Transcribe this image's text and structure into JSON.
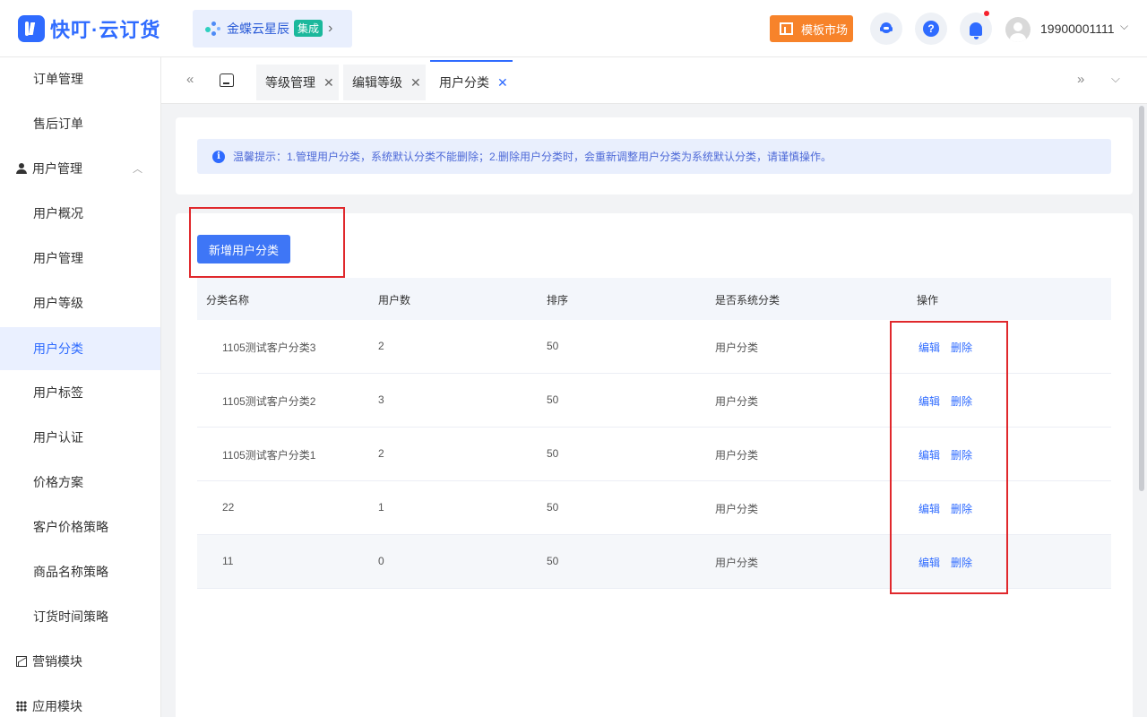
{
  "header": {
    "logo_text": "快叮·云订货",
    "company": "金蝶云星辰",
    "company_badge": "集成",
    "market_btn": "模板市场",
    "help_glyph": "?",
    "username": "19900001111",
    "icons": [
      "support-icon",
      "help-icon",
      "bell-icon",
      "avatar"
    ]
  },
  "sidebar": {
    "items": [
      {
        "label": "订单管理",
        "type": "sub"
      },
      {
        "label": "售后订单",
        "type": "sub"
      },
      {
        "label": "用户管理",
        "type": "group",
        "icon": "person-icon",
        "expanded": true
      },
      {
        "label": "用户概况",
        "type": "sub"
      },
      {
        "label": "用户管理",
        "type": "sub"
      },
      {
        "label": "用户等级",
        "type": "sub"
      },
      {
        "label": "用户分类",
        "type": "sub",
        "active": true
      },
      {
        "label": "用户标签",
        "type": "sub"
      },
      {
        "label": "用户认证",
        "type": "sub"
      },
      {
        "label": "价格方案",
        "type": "sub"
      },
      {
        "label": "客户价格策略",
        "type": "sub"
      },
      {
        "label": "商品名称策略",
        "type": "sub"
      },
      {
        "label": "订货时间策略",
        "type": "sub"
      },
      {
        "label": "营销模块",
        "type": "group",
        "icon": "chart-icon"
      },
      {
        "label": "应用模块",
        "type": "group",
        "icon": "grid-icon"
      }
    ]
  },
  "tabs": [
    {
      "label": "等级管理",
      "active": false
    },
    {
      "label": "编辑等级",
      "active": false
    },
    {
      "label": "用户分类",
      "active": true
    }
  ],
  "tip": {
    "info_glyph": "i",
    "text": "温馨提示：1.管理用户分类，系统默认分类不能删除；2.删除用户分类时，会重新调整用户分类为系统默认分类，请谨慎操作。"
  },
  "add_button": "新增用户分类",
  "table": {
    "headers": [
      "分类名称",
      "用户数",
      "排序",
      "是否系统分类",
      "操作"
    ],
    "rows": [
      {
        "name": "1105测试客户分类3",
        "count": "2",
        "sort": "50",
        "system": "用户分类"
      },
      {
        "name": "1105测试客户分类2",
        "count": "3",
        "sort": "50",
        "system": "用户分类"
      },
      {
        "name": "1105测试客户分类1",
        "count": "2",
        "sort": "50",
        "system": "用户分类"
      },
      {
        "name": "22",
        "count": "1",
        "sort": "50",
        "system": "用户分类"
      },
      {
        "name": "11",
        "count": "0",
        "sort": "50",
        "system": "用户分类"
      }
    ],
    "edit_label": "编辑",
    "delete_label": "删除"
  },
  "colors": {
    "primary": "#2f6bff",
    "orange": "#f7832a",
    "highlight_red": "#e0282c"
  }
}
